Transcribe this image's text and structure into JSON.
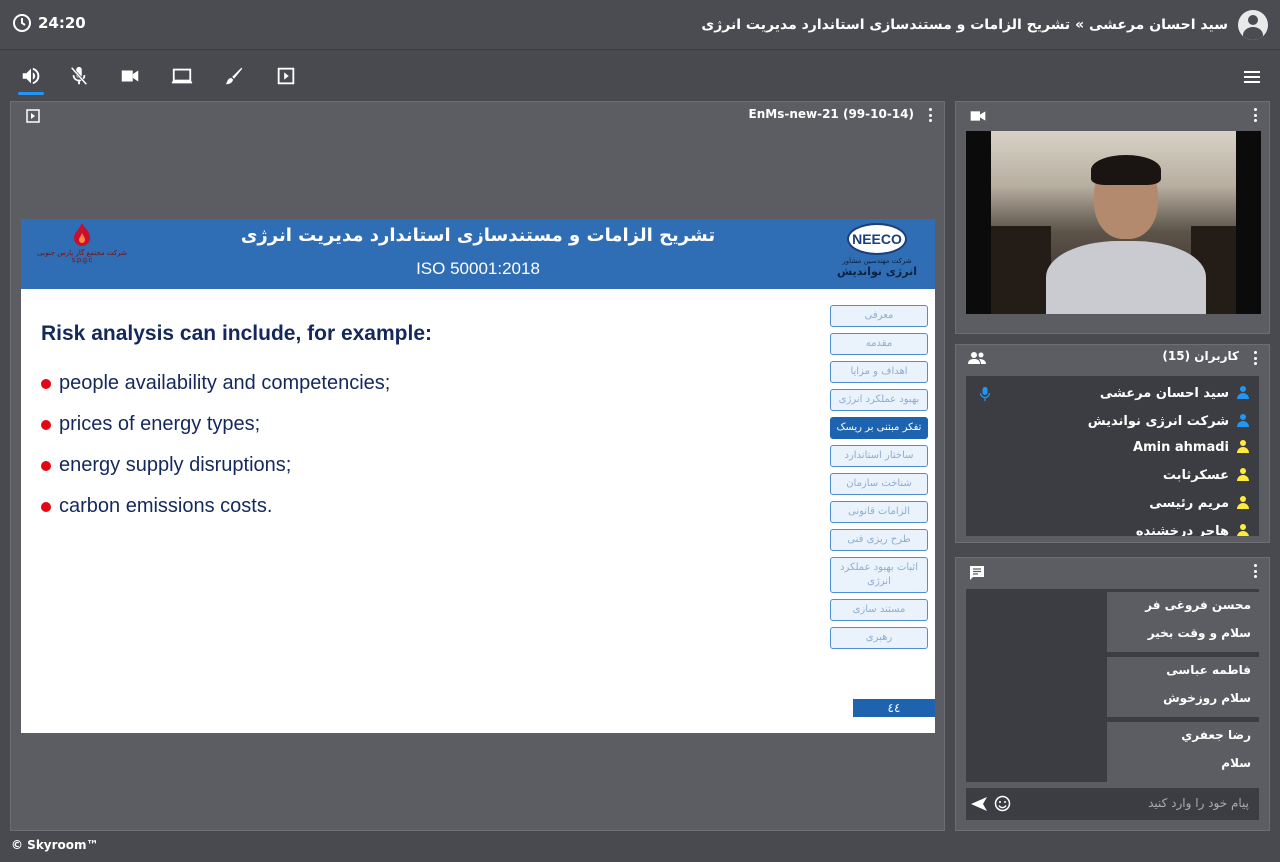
{
  "header": {
    "clock": "24:20",
    "title": "سید احسان مرعشی » تشریح الزامات و مستندسازی استاندارد مدیریت انرژی"
  },
  "toolbar": {
    "items": [
      "speaker-icon",
      "mic-muted-icon",
      "camera-icon",
      "screen-share-icon",
      "brush-icon",
      "presentation-icon"
    ],
    "active": "speaker-icon",
    "accent": "#2196f3"
  },
  "main": {
    "file_title": "EnMs-new-21 (99-10-14)"
  },
  "slide": {
    "title": "تشریح الزامات و مستندسازی استاندارد مدیریت انرژی",
    "subtitle": "ISO 50001:2018",
    "logo_right": {
      "text": "NEECO",
      "sub1": "شرکت مهندسین مشاور",
      "sub2": "انرژی نواندیش"
    },
    "logo_left": {
      "sub1": "شرکت مجتمع گاز پارس جنوبی",
      "sub2": "s.p.g.c"
    },
    "heading": "Risk analysis can include, for example:",
    "bullets": [
      "people availability and competencies;",
      "prices of energy types;",
      "energy supply disruptions;",
      "carbon emissions costs."
    ],
    "nav": [
      "معرفی",
      "مقدمه",
      "اهداف و مزایا",
      "بهبود عملکرد انرژی",
      "تفکر مبتنی بر ریسک",
      "ساختار استاندارد",
      "شناخت سازمان",
      "الزامات قانونی",
      "طرح ریزی فنی",
      "اثبات بهبود عملکرد انرژی",
      "مستند سازی",
      "رهبری"
    ],
    "nav_active": "تفکر مبتنی بر ریسک",
    "page": "٤٤",
    "colors": {
      "header": "#2f6db5",
      "text": "#14285c",
      "bullet": "#e30613"
    }
  },
  "users": {
    "title": "کاربران (15)",
    "list": [
      {
        "name": "سید احسان مرعشی",
        "color": "#2196f3",
        "mic": true
      },
      {
        "name": "شرکت انرژی نواندیش",
        "color": "#2196f3",
        "mic": false
      },
      {
        "name": "Amin ahmadi",
        "color": "#ffeb3b",
        "mic": false
      },
      {
        "name": "عسکرثابت",
        "color": "#ffeb3b",
        "mic": false
      },
      {
        "name": "مریم رئیسی",
        "color": "#ffeb3b",
        "mic": false
      },
      {
        "name": "هاجر درخشنده",
        "color": "#ffeb3b",
        "mic": false
      }
    ]
  },
  "chat": {
    "messages": [
      {
        "name": "محسن فروغی فر",
        "text": "سلام و وقت بخیر"
      },
      {
        "name": "فاطمه عباسی",
        "text": "سلام روزخوش"
      },
      {
        "name": "رضا جعفري",
        "text": "سلام"
      }
    ],
    "placeholder": "پیام خود را وارد کنید"
  },
  "footer": {
    "text": "© Skyroom™"
  }
}
